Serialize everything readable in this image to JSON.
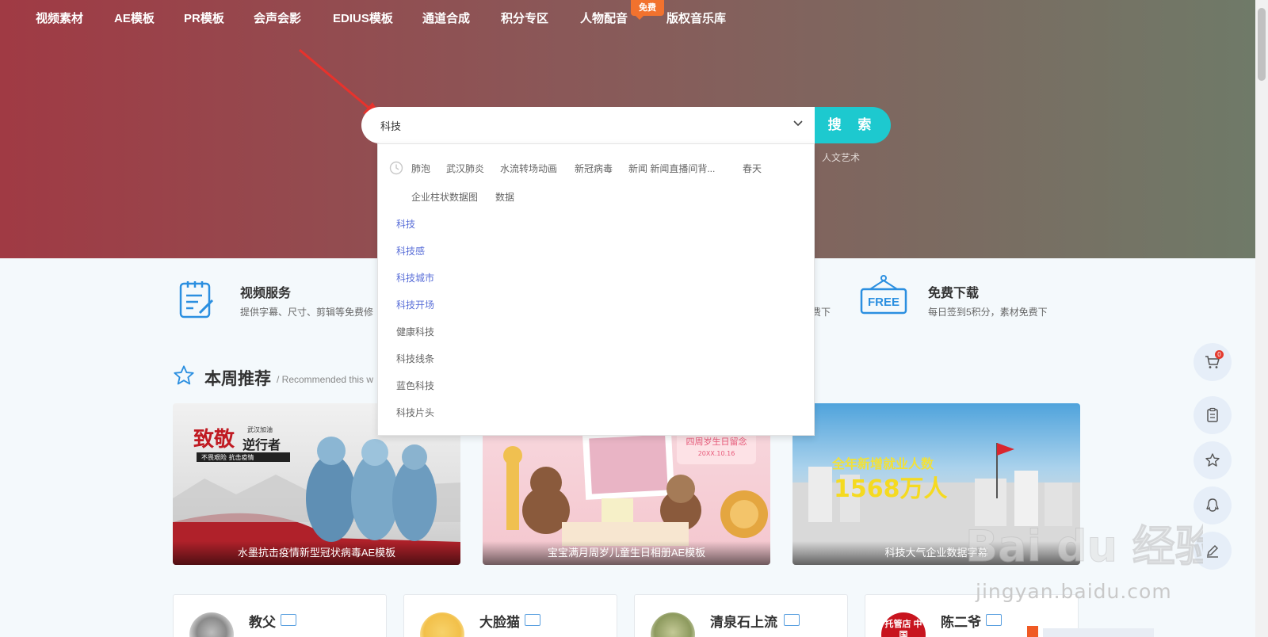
{
  "nav": {
    "items": [
      "视频素材",
      "AE模板",
      "PR模板",
      "会声会影",
      "EDIUS模板",
      "通道合成",
      "积分专区",
      "人物配音",
      "版权音乐库"
    ],
    "badge": "免费"
  },
  "search": {
    "value": "科技",
    "button": "搜 索",
    "hot_word": "人文艺术"
  },
  "dropdown": {
    "history": [
      "肺泡",
      "武汉肺炎",
      "水流转场动画",
      "新冠病毒",
      "新闻 新闻直播间背...",
      "春天",
      "企业柱状数据图",
      "数据"
    ],
    "suggestions": [
      "科技",
      "科技感",
      "科技城市",
      "科技开场",
      "健康科技",
      "科技线条",
      "蓝色科技",
      "科技片头"
    ]
  },
  "services": [
    {
      "title": "视频服务",
      "desc": "提供字幕、尺寸、剪辑等免费修"
    },
    {
      "title": "",
      "desc": "免费下"
    },
    {
      "title": "免费下载",
      "desc": "每日签到5积分，素材免费下"
    }
  ],
  "section": {
    "title": "本周推荐",
    "subtitle": "/ Recommended this w"
  },
  "cards": [
    {
      "caption": "水墨抗击疫情新型冠状病毒AE模板",
      "art_lines": [
        "致敬",
        "逆行者",
        "武汉加油",
        "不畏艰险  抗击疫情"
      ]
    },
    {
      "caption": "宝宝满月周岁儿童生日相册AE模板",
      "art_lines": [
        "四周岁生日留念",
        "20XX.10.16"
      ]
    },
    {
      "caption": "科技大气企业数据字幕",
      "art_lines": [
        "全年新增就业人数",
        "1568万人"
      ]
    }
  ],
  "users": [
    {
      "name": "教父"
    },
    {
      "name": "大脸猫"
    },
    {
      "name": "清泉石上流"
    },
    {
      "name": "陈二爷",
      "avatar_text": "托管店 中 国"
    }
  ],
  "float": {
    "cart_count": "0"
  },
  "watermark": {
    "domain": "jingyan.baidu.com",
    "brand": "Bai du 经验"
  },
  "colors": {
    "accent": "#1dc9cf",
    "link": "#5a6fd8",
    "badge": "#f2722e"
  }
}
